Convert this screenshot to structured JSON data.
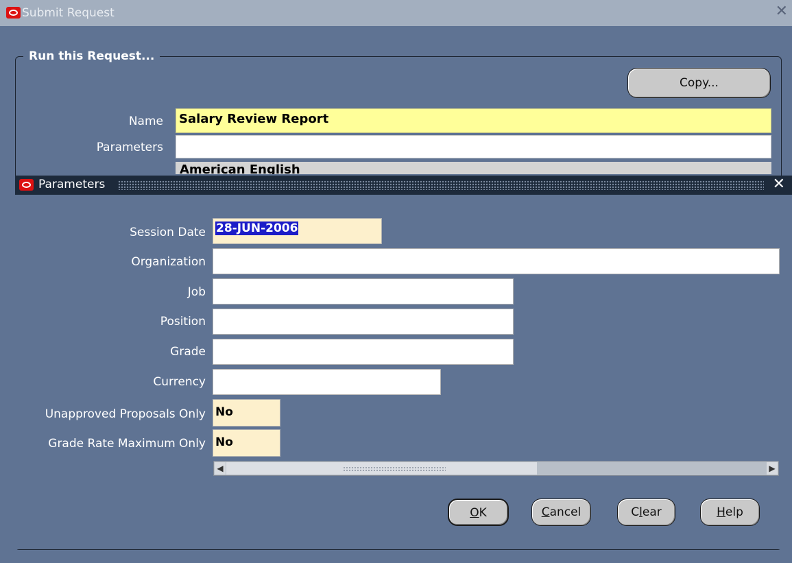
{
  "outer": {
    "title": "Submit Request",
    "group_label": "Run this Request...",
    "copy_label": "Copy...",
    "name_label": "Name",
    "name_value": "Salary Review Report",
    "parameters_label": "Parameters",
    "parameters_value": "",
    "language_value_partial": "American English"
  },
  "params_dialog": {
    "title": "Parameters",
    "fields": [
      {
        "label": "Session Date",
        "value": "28-JUN-2006"
      },
      {
        "label": "Organization",
        "value": ""
      },
      {
        "label": "Job",
        "value": ""
      },
      {
        "label": "Position",
        "value": ""
      },
      {
        "label": "Grade",
        "value": ""
      },
      {
        "label": "Currency",
        "value": ""
      },
      {
        "label": "Unapproved Proposals Only",
        "value": "No"
      },
      {
        "label": "Grade Rate Maximum Only",
        "value": "No"
      }
    ],
    "buttons": {
      "ok": {
        "pre": "",
        "mnemonic": "O",
        "post": "K"
      },
      "cancel": {
        "pre": "",
        "mnemonic": "C",
        "post": "ancel"
      },
      "clear": {
        "pre": "C",
        "mnemonic": "l",
        "post": "ear"
      },
      "help": {
        "pre": "",
        "mnemonic": "H",
        "post": "elp"
      }
    }
  },
  "colors": {
    "window_bg": "#5f7393",
    "outer_titlebar": "#a3afbf",
    "dialog_titlebar": "#1d2a3b",
    "required_field": "#ffff99",
    "selection": "#1c1cc8"
  },
  "icons": {
    "app_logo": "oracle-logo-icon",
    "close": "close-icon"
  }
}
